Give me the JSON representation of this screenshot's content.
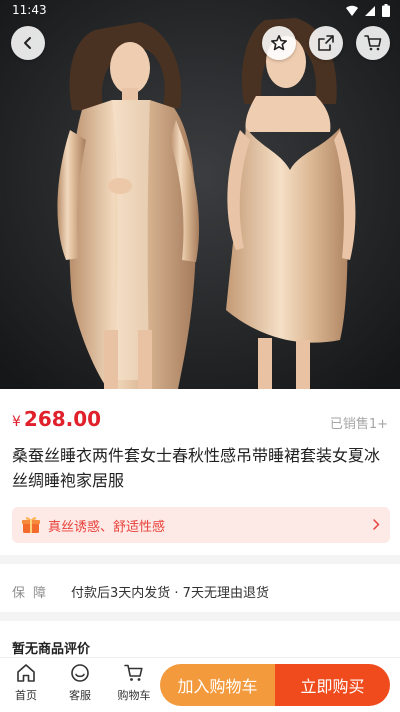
{
  "status_bar": {
    "time": "11:43"
  },
  "header": {
    "back_icon": "chevron-left-icon",
    "favorite_icon": "star-icon",
    "share_icon": "share-icon",
    "cart_icon": "cart-icon"
  },
  "product": {
    "currency": "¥",
    "price": "268.00",
    "sold": "已销售1+",
    "title": "桑蚕丝睡衣两件套女士春秋性感吊带睡裙套装女夏冰丝绸睡袍家居服",
    "promo": "真丝诱惑、舒适性感"
  },
  "guarantee": {
    "label": "保障",
    "text": "付款后3天内发货 · 7天无理由退货"
  },
  "reviews": {
    "title": "暂无商品评价"
  },
  "bottom_bar": {
    "home_label": "首页",
    "service_label": "客服",
    "cart_label": "购物车",
    "add_to_cart_label": "加入购物车",
    "buy_now_label": "立即购买"
  },
  "colors": {
    "price": "#e0202a",
    "promo_bg": "#fde9e6",
    "cart_button": "#f39a3d",
    "buy_button": "#ef4b1d"
  }
}
